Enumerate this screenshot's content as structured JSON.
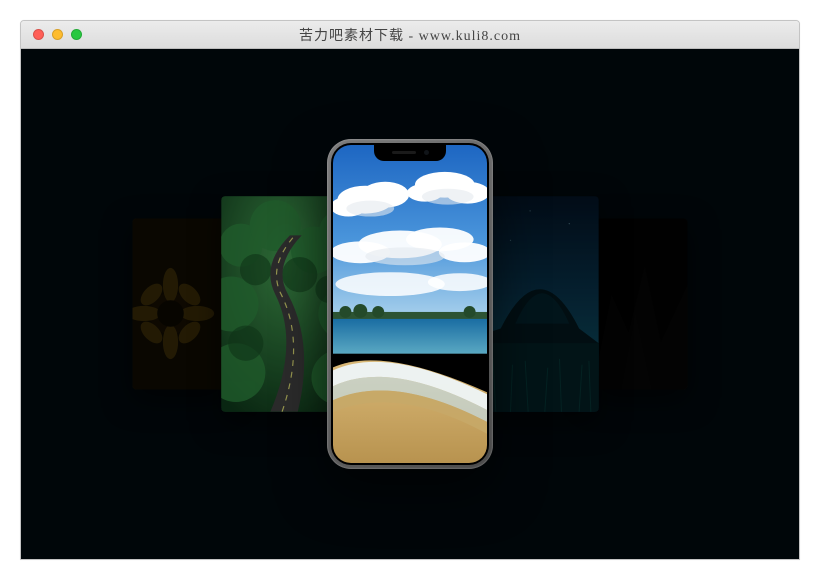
{
  "window": {
    "title": "苦力吧素材下载 - www.kuli8.com"
  },
  "carousel": {
    "items": [
      {
        "name": "sunflower",
        "description": "Sunflower close-up"
      },
      {
        "name": "forest-road",
        "description": "Winding road through green forest"
      },
      {
        "name": "beach",
        "description": "Tropical beach with blue sky and clouds"
      },
      {
        "name": "night-mountain",
        "description": "Mountain silhouette at night with teal sky"
      },
      {
        "name": "dark-rock",
        "description": "Dark rock texture"
      }
    ],
    "active_index": 2
  }
}
